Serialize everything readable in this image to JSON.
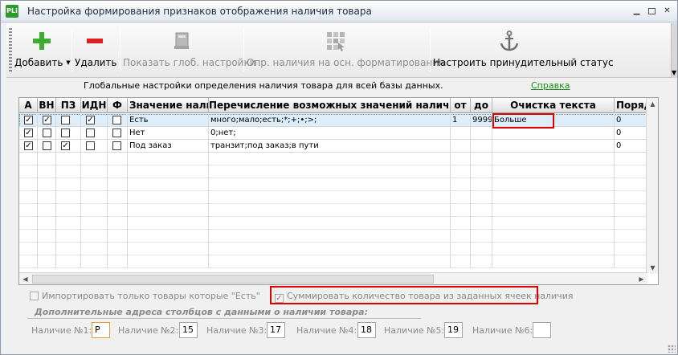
{
  "window": {
    "title": "Настройка формирования признаков отображения наличия товара",
    "app_icon": "PLi"
  },
  "toolbar": {
    "add_label": "Добавить",
    "delete_label": "Удалить",
    "show_global_label": "Показать глоб. настройки",
    "determine_label": "Опр. наличия на осн. форматирования",
    "force_status_label": "Настроить принудительный статус"
  },
  "header_strip": {
    "text": "Глобальные настройки определения наличия товара для всей базы данных.",
    "help_link": "Справка"
  },
  "grid": {
    "columns": [
      "А",
      "ВН",
      "ПЗ",
      "ИДН",
      "Ф",
      "Значение налич",
      "Перечисление возможных значений наличия",
      "от",
      "до",
      "Очистка текста",
      "Поряд"
    ],
    "rows": [
      {
        "a": true,
        "vn": true,
        "pz": false,
        "idn": true,
        "f": false,
        "value": "Есть",
        "enum": "много;мало;есть;*;+;•;>;",
        "from": "1",
        "to": "9999",
        "clean": "Больше",
        "order": "0"
      },
      {
        "a": true,
        "vn": false,
        "pz": false,
        "idn": false,
        "f": false,
        "value": "Нет",
        "enum": "0;нет;",
        "from": "",
        "to": "",
        "clean": "",
        "order": "0"
      },
      {
        "a": true,
        "vn": false,
        "pz": true,
        "idn": false,
        "f": false,
        "value": "Под заказ",
        "enum": "транзит;под заказ;в пути",
        "from": "",
        "to": "",
        "clean": "",
        "order": "0"
      }
    ]
  },
  "options": {
    "import_only_label": "Импортировать только товары которые \"Есть\"",
    "import_only_checked": false,
    "sum_label": "Суммировать количество товара из заданных ячеек наличия",
    "sum_checked": true
  },
  "extra": {
    "title": "Дополнительные адреса столбцов с данными о наличии товара:",
    "fields": [
      {
        "label": "Наличие №1:",
        "value": "P"
      },
      {
        "label": "Наличие №2:",
        "value": "15"
      },
      {
        "label": "Наличие №3:",
        "value": "17"
      },
      {
        "label": "Наличие №4:",
        "value": "18"
      },
      {
        "label": "Наличие №5:",
        "value": "19"
      },
      {
        "label": "Наличие №6:",
        "value": ""
      }
    ]
  },
  "colors": {
    "accent_red": "#e00000",
    "link_green": "#1a8c1a",
    "selection": "#ddeefa"
  }
}
